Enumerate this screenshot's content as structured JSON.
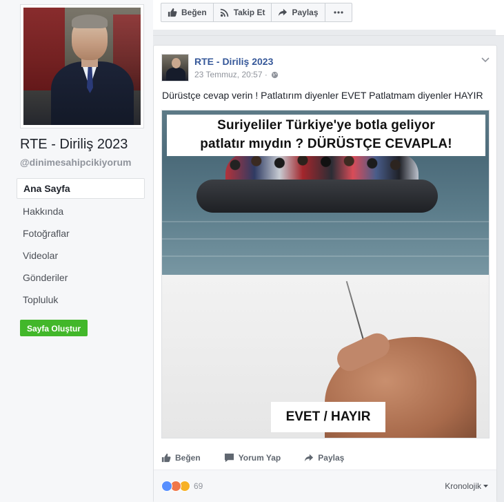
{
  "profile": {
    "name": "RTE - Diriliş 2023",
    "handle": "@dinimesahipcikiyorum"
  },
  "nav": {
    "items": [
      {
        "label": "Ana Sayfa",
        "active": true
      },
      {
        "label": "Hakkında"
      },
      {
        "label": "Fotoğraflar"
      },
      {
        "label": "Videolar"
      },
      {
        "label": "Gönderiler"
      },
      {
        "label": "Topluluk"
      }
    ],
    "create_page": "Sayfa Oluştur"
  },
  "top_actions": {
    "like": "Beğen",
    "follow": "Takip Et",
    "share": "Paylaş",
    "more_icon": "more-icon"
  },
  "post": {
    "author": "RTE - Diriliş 2023",
    "date": "23 Temmuz, 20:57 ·",
    "text": "Dürüstçe cevap verin ! Patlatırım diyenler EVET Patlatmam diyenler HAYIR",
    "image": {
      "title_line1": "Suriyeliler Türkiye'ye botla geliyor",
      "title_line2": "patlatır mıydın ? DÜRÜSTÇE CEVAPLA!",
      "bottom_label": "EVET / HAYIR"
    },
    "actions": {
      "like": "Beğen",
      "comment": "Yorum Yap",
      "share": "Paylaş"
    },
    "reactions": {
      "count": "69",
      "types": [
        "like",
        "angry",
        "haha"
      ]
    },
    "sort": "Kronolojik"
  },
  "colors": {
    "link": "#365899",
    "create_button": "#42b72a",
    "like_reaction": "#5890ff"
  }
}
